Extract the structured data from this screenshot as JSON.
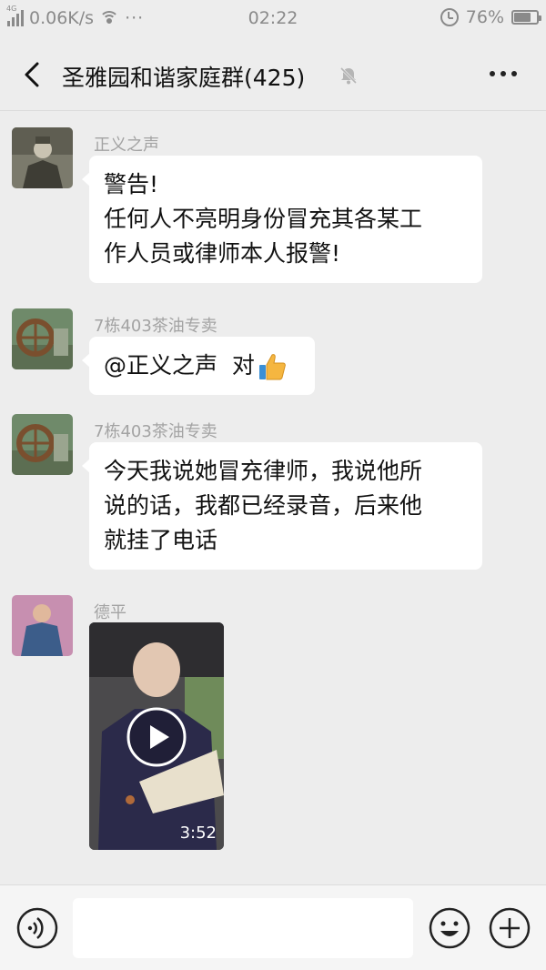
{
  "status_bar": {
    "network": "4G",
    "speed": "0.06K/s",
    "more": "···",
    "time": "02:22",
    "battery": "76%",
    "battery_level": 0.76
  },
  "header": {
    "title": "圣雅园和谐家庭群(425)",
    "back_icon": "chevron-left-icon",
    "mute_icon": "bell-off-icon",
    "more_icon": "more-horizontal-icon"
  },
  "messages": [
    {
      "sender": "正义之声",
      "lines": [
        "警告!",
        "任何人不亮明身份冒充其各某工",
        "作人员或律师本人报警!"
      ]
    },
    {
      "sender": "7栋403茶油专卖",
      "lines": [
        "@正义之声  对"
      ],
      "emoji": "thumbs-up-icon"
    },
    {
      "sender": "7栋403茶油专卖",
      "lines": [
        "今天我说她冒充律师，我说他所",
        "说的话，我都已经录音，后来他",
        "就挂了电话"
      ]
    },
    {
      "sender": "德平",
      "video": {
        "duration": "3:52",
        "icon": "play-icon"
      }
    }
  ],
  "input_bar": {
    "voice_icon": "voice-icon",
    "placeholder": "",
    "emoji_icon": "smile-icon",
    "add_icon": "plus-circle-icon"
  },
  "colors": {
    "background": "#ededed",
    "bubble": "#ffffff",
    "sender_text": "#a3a3a3"
  }
}
